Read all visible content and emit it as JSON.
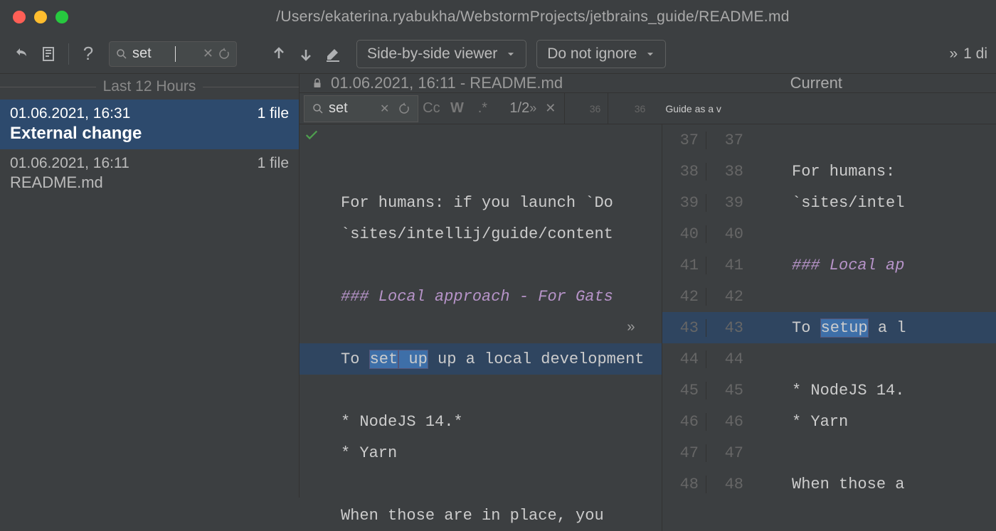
{
  "titlebar": {
    "path": "/Users/ekaterina.ryabukha/WebstormProjects/jetbrains_guide/README.md"
  },
  "toolbar": {
    "search_value": "set",
    "viewer_mode": "Side-by-side viewer",
    "ignore_mode": "Do not ignore",
    "overflow_label": "1 di"
  },
  "sidebar": {
    "group_label": "Last 12 Hours",
    "items": [
      {
        "timestamp": "01.06.2021, 16:31",
        "count": "1 file",
        "title": "External change",
        "selected": true
      },
      {
        "timestamp": "01.06.2021, 16:11",
        "count": "1 file",
        "title": "README.md",
        "selected": false
      }
    ]
  },
  "diff": {
    "left_header": "01.06.2021, 16:11 - README.md",
    "right_header": "Current",
    "search_value": "set",
    "match_count": "1/2",
    "left_lines": [
      {
        "num": "36",
        "text": ""
      },
      {
        "num": "37",
        "text": ""
      },
      {
        "num": "38",
        "text": "For humans: if you launch `Do"
      },
      {
        "num": "39",
        "text": "`sites/intellij/guide/content"
      },
      {
        "num": "40",
        "text": ""
      },
      {
        "num": "41",
        "text": "### Local approach - For Gats",
        "style": "heading"
      },
      {
        "num": "42",
        "text": ""
      },
      {
        "num": "43",
        "text": "To set up a local development",
        "style": "modified",
        "highlight": "set"
      },
      {
        "num": "44",
        "text": ""
      },
      {
        "num": "45",
        "text": "* NodeJS 14.*"
      },
      {
        "num": "46",
        "text": "* Yarn"
      },
      {
        "num": "47",
        "text": ""
      },
      {
        "num": "48",
        "text": "When those are in place, you"
      }
    ],
    "right_lines": [
      {
        "num": "36",
        "text": "Guide as a v"
      },
      {
        "num": "37",
        "text": ""
      },
      {
        "num": "38",
        "text": "For humans: "
      },
      {
        "num": "39",
        "text": "`sites/intel"
      },
      {
        "num": "40",
        "text": ""
      },
      {
        "num": "41",
        "text": "### Local ap",
        "style": "heading"
      },
      {
        "num": "42",
        "text": ""
      },
      {
        "num": "43",
        "text": "To setup a l",
        "style": "modified",
        "highlight": "setup"
      },
      {
        "num": "44",
        "text": ""
      },
      {
        "num": "45",
        "text": "* NodeJS 14."
      },
      {
        "num": "46",
        "text": "* Yarn"
      },
      {
        "num": "47",
        "text": ""
      },
      {
        "num": "48",
        "text": "When those a"
      }
    ]
  }
}
